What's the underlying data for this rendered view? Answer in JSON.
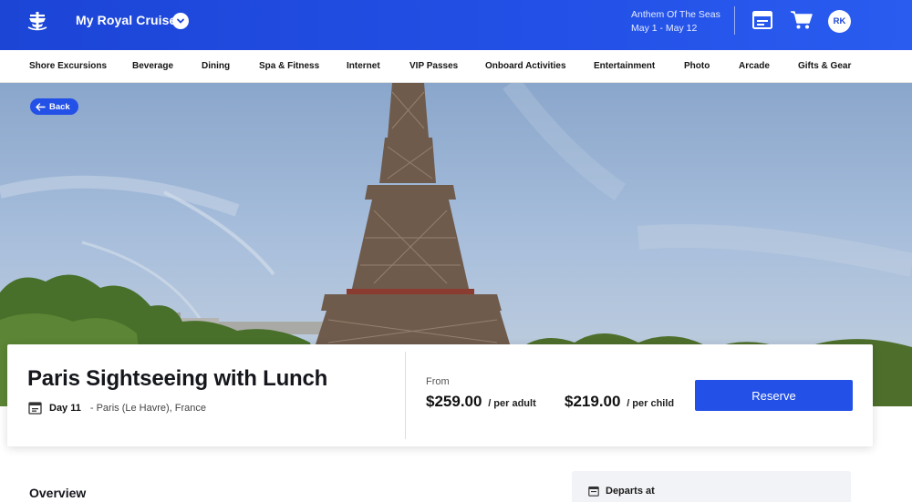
{
  "header": {
    "app_title": "My Royal Cruise",
    "ship_name": "Anthem Of The Seas",
    "dates": "May 1 - May 12",
    "avatar_initials": "RK",
    "icons": [
      "royal-caribbean-logo-icon",
      "chevron-down-icon",
      "calendar-icon",
      "cart-icon"
    ]
  },
  "nav": {
    "items": [
      {
        "label": "Shore Excursions"
      },
      {
        "label": "Beverage"
      },
      {
        "label": "Dining"
      },
      {
        "label": "Spa & Fitness"
      },
      {
        "label": "Internet"
      },
      {
        "label": "VIP Passes"
      },
      {
        "label": "Onboard Activities"
      },
      {
        "label": "Entertainment"
      },
      {
        "label": "Photo"
      },
      {
        "label": "Arcade"
      },
      {
        "label": "Gifts & Gear"
      }
    ]
  },
  "hero": {
    "back_label": "Back",
    "image_subject": "Eiffel Tower"
  },
  "product": {
    "title": "Paris Sightseeing with Lunch",
    "day": "Day 11",
    "location": "- Paris (Le Havre), France",
    "from_label": "From",
    "adult_price": "$259.00",
    "adult_unit": "/ per adult",
    "child_price": "$219.00",
    "child_unit": "/ per child",
    "reserve_label": "Reserve"
  },
  "details": {
    "overview_heading": "Overview",
    "departs_label": "Departs at"
  },
  "colors": {
    "brand_blue": "#2350e6",
    "header_blue": "#1c45d6",
    "text_dark": "#15171c"
  }
}
